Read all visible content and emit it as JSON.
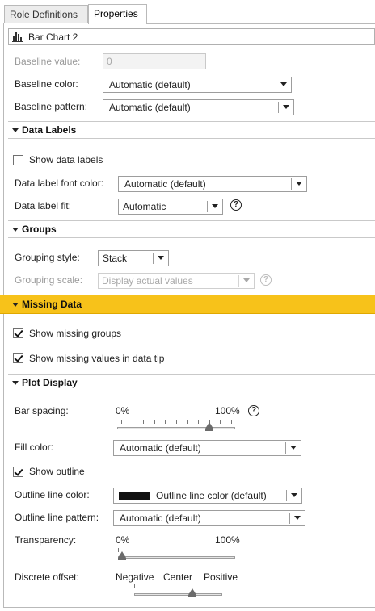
{
  "tabs": [
    "Role Definitions",
    "Properties"
  ],
  "object_selector": {
    "icon": "bar-chart-icon",
    "label": "Bar Chart 2"
  },
  "baseline": {
    "value_label": "Baseline value:",
    "value": "0",
    "color_label": "Baseline color:",
    "color": "Automatic (default)",
    "pattern_label": "Baseline pattern:",
    "pattern": "Automatic (default)"
  },
  "data_labels": {
    "title": "Data Labels",
    "show_label": "Show data labels",
    "show_checked": false,
    "font_color_label": "Data label font color:",
    "font_color": "Automatic (default)",
    "fit_label": "Data label fit:",
    "fit": "Automatic"
  },
  "groups": {
    "title": "Groups",
    "style_label": "Grouping style:",
    "style": "Stack",
    "scale_label": "Grouping scale:",
    "scale": "Display actual values"
  },
  "missing_data": {
    "title": "Missing Data",
    "show_groups": "Show missing groups",
    "show_groups_checked": true,
    "show_values": "Show missing values in data tip",
    "show_values_checked": true
  },
  "plot_display": {
    "title": "Plot Display",
    "bar_spacing_label": "Bar spacing:",
    "bar_spacing_min": "0%",
    "bar_spacing_max": "100%",
    "bar_spacing_value": 0.8,
    "fill_color_label": "Fill color:",
    "fill_color": "Automatic (default)",
    "show_outline": "Show outline",
    "show_outline_checked": true,
    "outline_color_label": "Outline line color:",
    "outline_color": "Outline line color (default)",
    "outline_swatch": "#111111",
    "outline_pattern_label": "Outline line pattern:",
    "outline_pattern": "Automatic (default)",
    "transparency_label": "Transparency:",
    "transparency_min": "0%",
    "transparency_max": "100%",
    "transparency_value": 0.0,
    "offset_label": "Discrete offset:",
    "offset_negative": "Negative",
    "offset_center": "Center",
    "offset_positive": "Positive",
    "offset_value": 0.68
  },
  "help_symbol": "?",
  "colors": {
    "accent_section": "#f7c21a"
  }
}
